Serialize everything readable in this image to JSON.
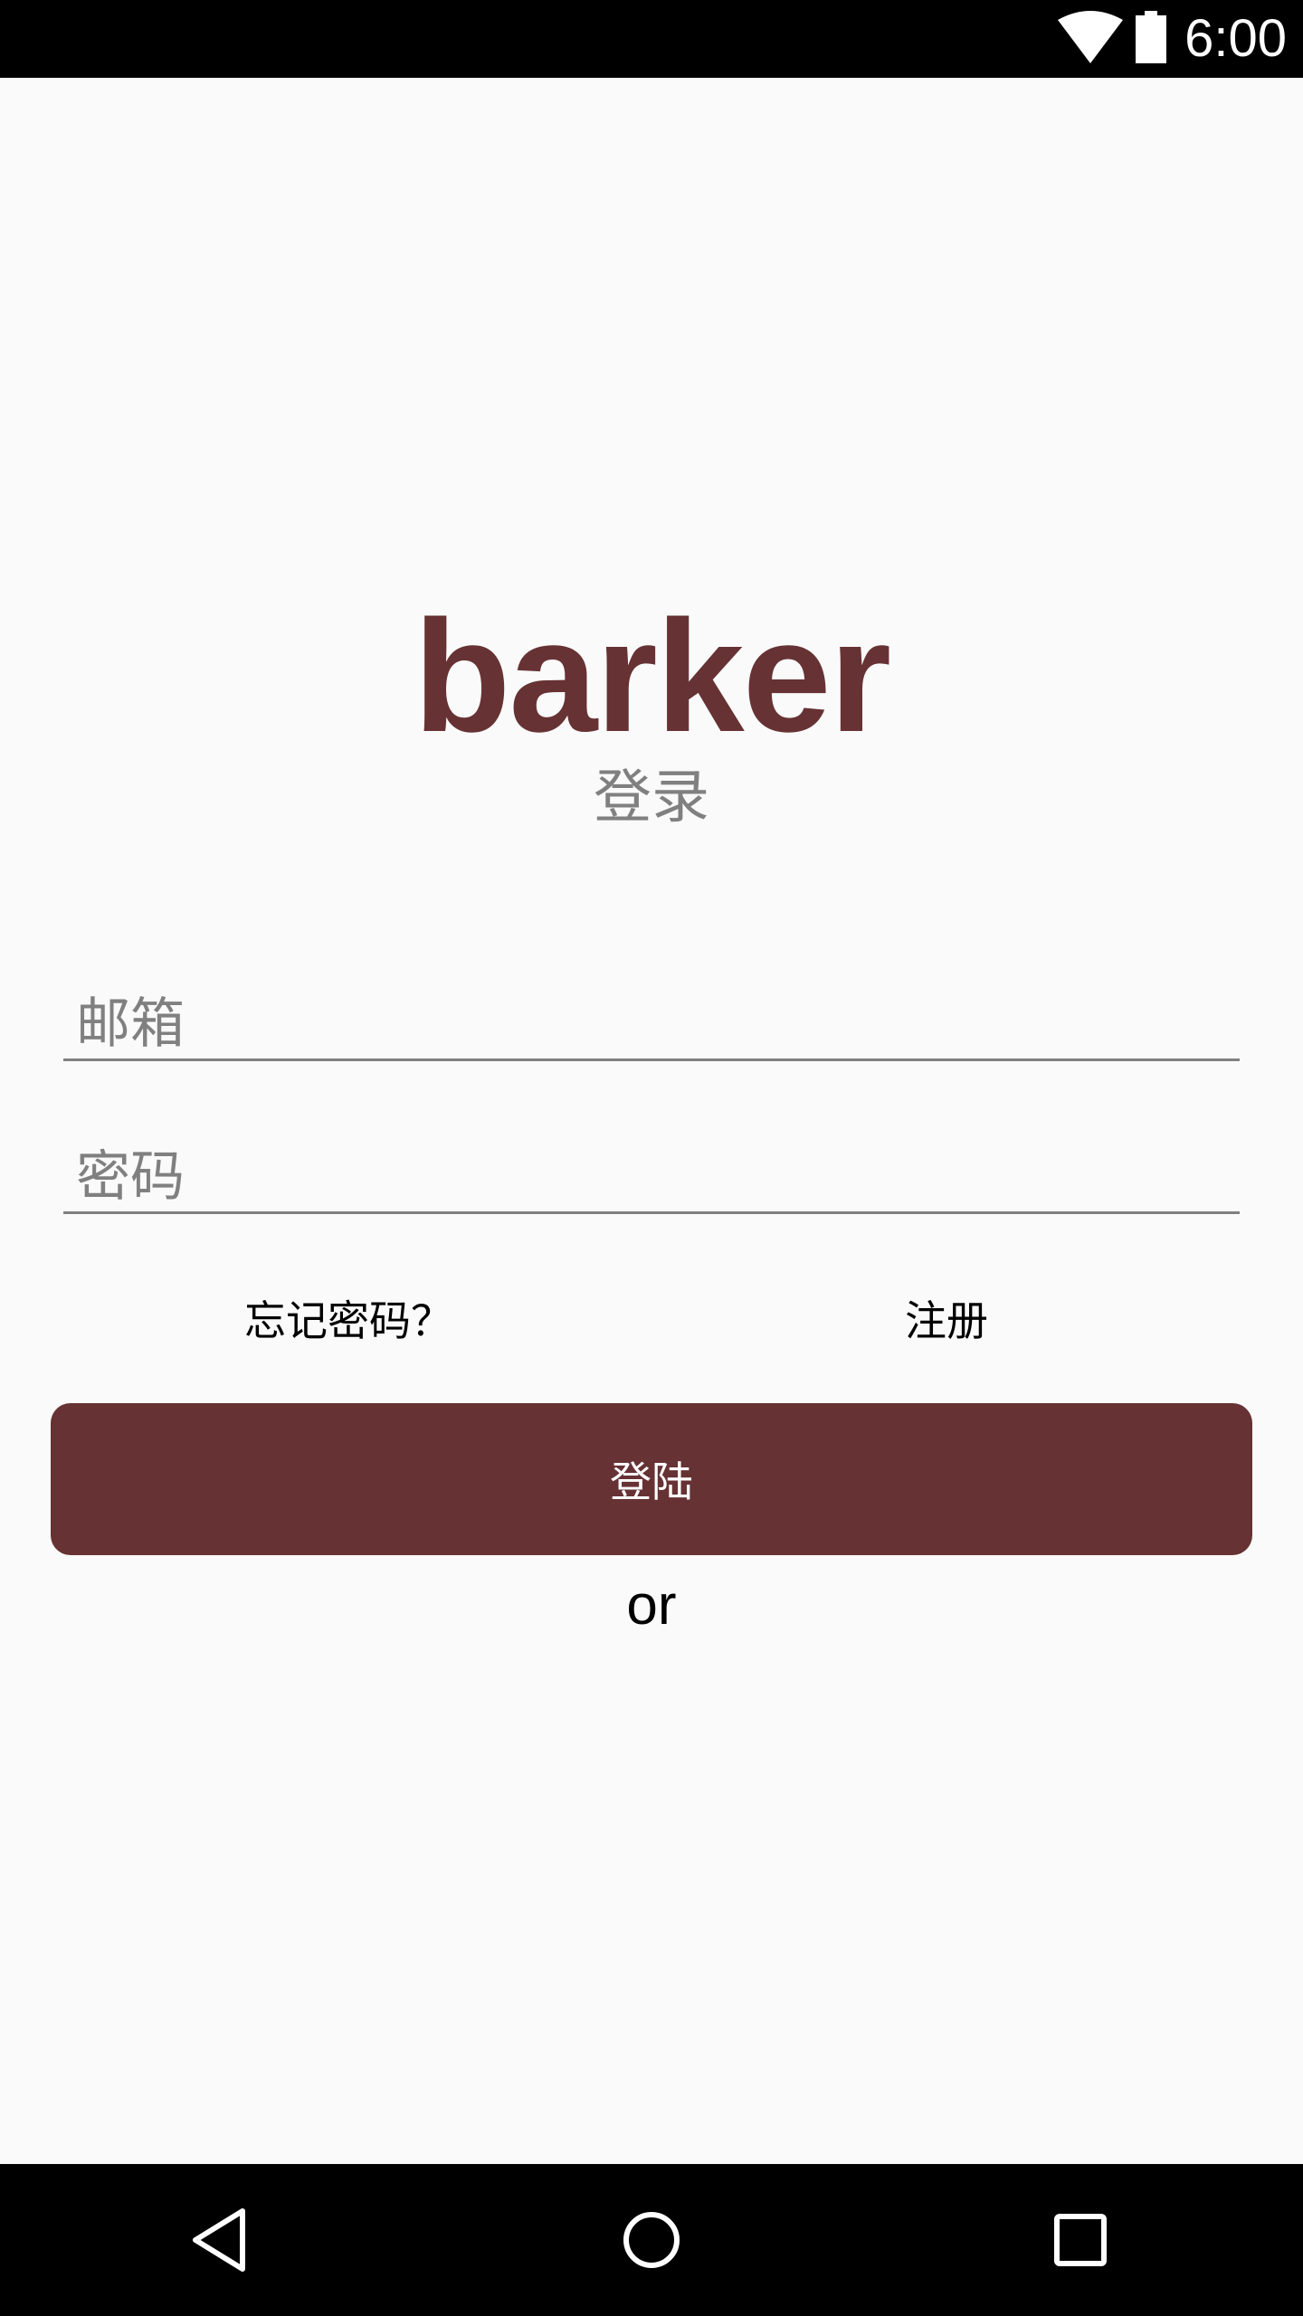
{
  "status_bar": {
    "time": "6:00",
    "icons": [
      "wifi-icon",
      "battery-icon"
    ]
  },
  "app": {
    "title": "barker",
    "subtitle": "登录"
  },
  "form": {
    "email_placeholder": "邮箱",
    "email_value": "",
    "password_placeholder": "密码",
    "password_value": "",
    "forgot_password_label": "忘记密码？",
    "register_label": "注册",
    "login_button_label": "登陆",
    "or_label": "or"
  },
  "nav_bar": {
    "icons": [
      "back-icon",
      "home-icon",
      "recents-icon"
    ]
  },
  "colors": {
    "brand": "#673234",
    "background": "#fafafa",
    "muted_text": "#808080",
    "bars": "#000000"
  }
}
